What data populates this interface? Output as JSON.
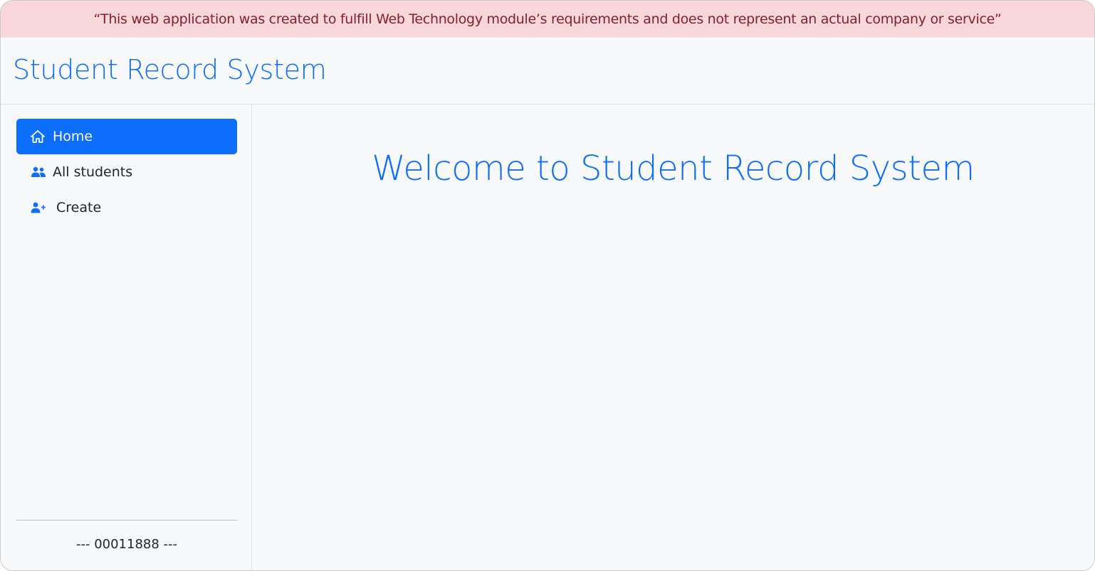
{
  "disclaimer": {
    "text": "“This web application was created to fulfill Web Technology module’s requirements and does not represent an actual company or service”"
  },
  "header": {
    "brand": "Student Record System"
  },
  "sidebar": {
    "items": [
      {
        "label": "Home",
        "icon": "home-icon",
        "active": true
      },
      {
        "label": "All students",
        "icon": "users-icon",
        "active": false
      },
      {
        "label": "Create",
        "icon": "user-plus-icon",
        "active": false
      }
    ],
    "footer_id": "--- 00011888 ---"
  },
  "main": {
    "welcome": "Welcome to Student Record System"
  },
  "colors": {
    "accent": "#0d6efd",
    "disclaimer_bg": "#f8d7da",
    "disclaimer_text": "#842029",
    "background": "#f8f9fa"
  }
}
